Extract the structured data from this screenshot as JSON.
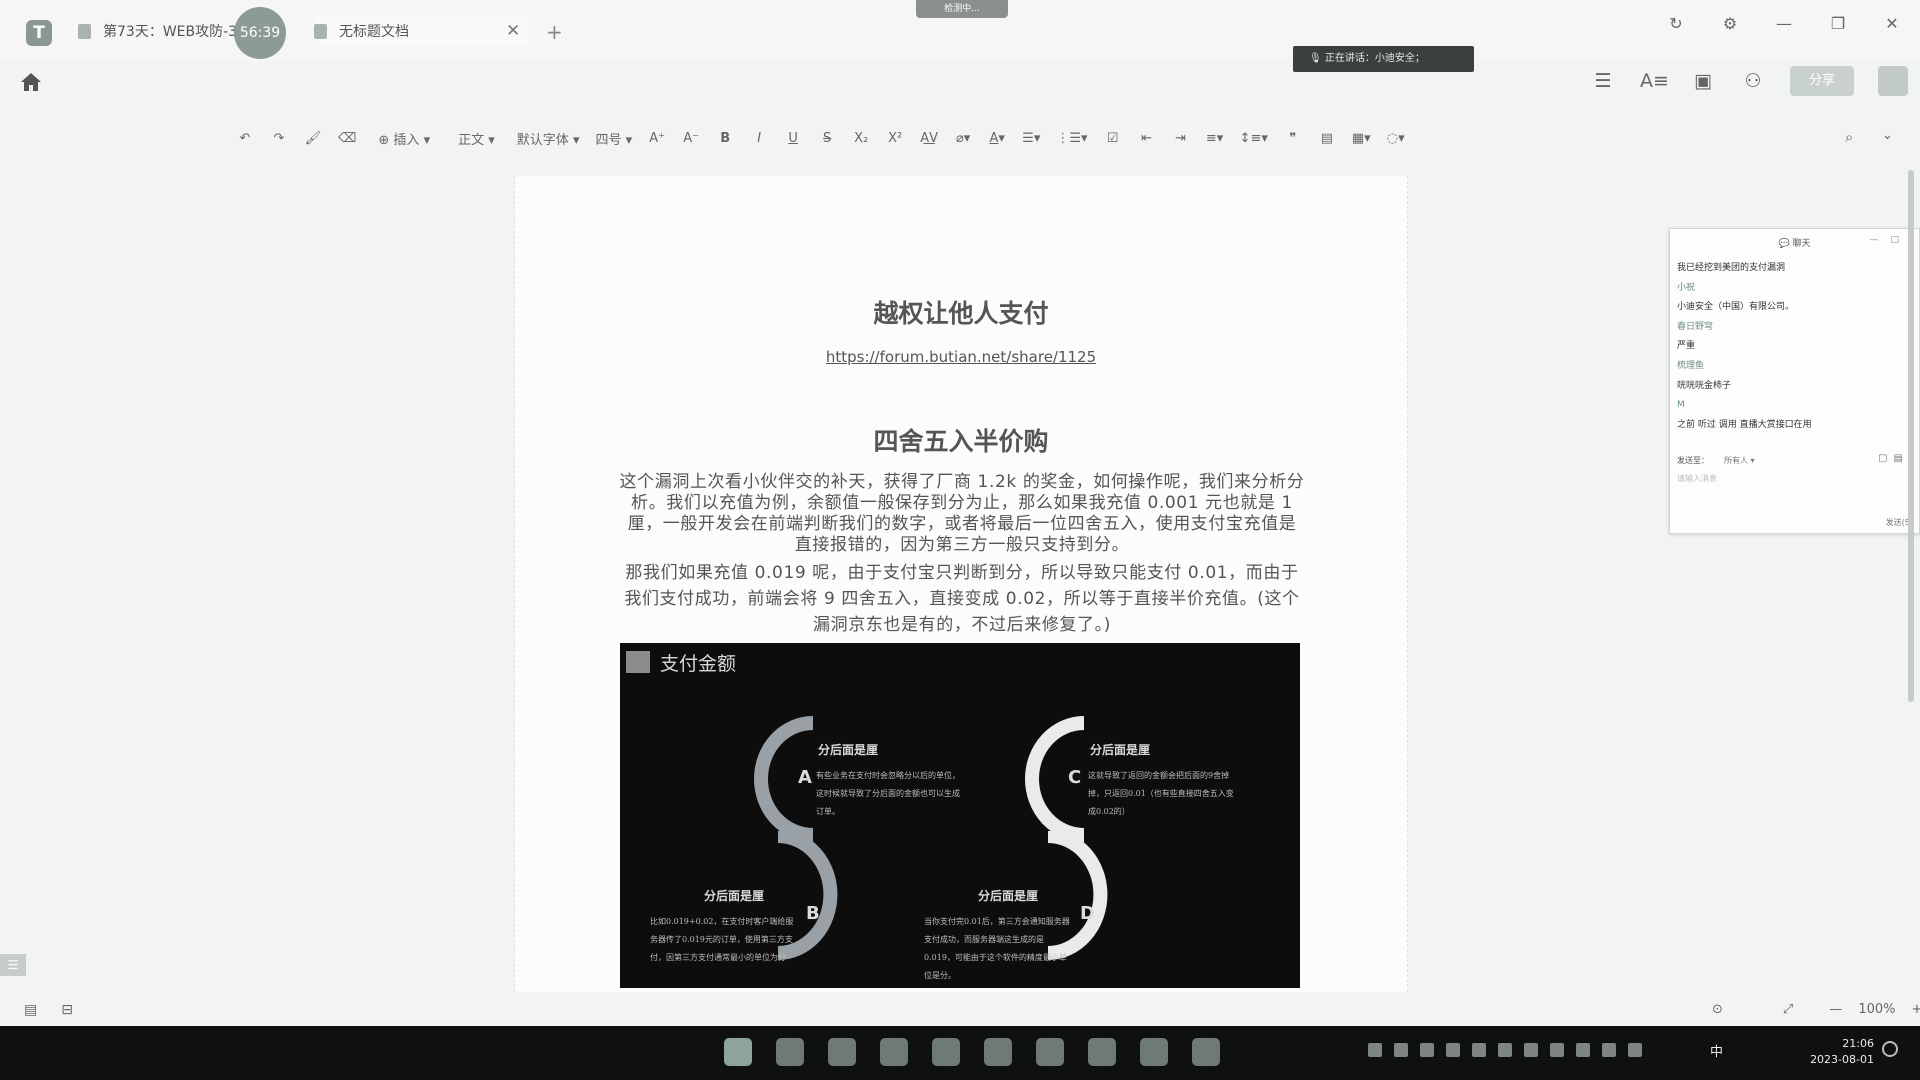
{
  "tabs": [
    {
      "label": "第73天：WEB攻防-3",
      "timer": "56:39"
    },
    {
      "label": "无标题文档"
    }
  ],
  "window": {
    "recording_badge": "检测中...",
    "speaking_label": "正在讲话：小迪安全；"
  },
  "header": {
    "share_label": "分享"
  },
  "toolbar": {
    "insert_label": "插入",
    "style_label": "正文",
    "font_label": "默认字体",
    "size_label": "四号"
  },
  "document": {
    "title1": "越权让他人支付",
    "link": "https://forum.butian.net/share/1125",
    "title2": "四舍五入半价购",
    "para1": "这个漏洞上次看小伙伴交的补天，获得了厂商 1.2k 的奖金，如何操作呢，我们来分析分析。我们以充值为例，余额值一般保存到分为止，那么如果我充值 0.001 元也就是 1 厘，一般开发会在前端判断我们的数字，或者将最后一位四舍五入，使用支付宝充值是直接报错的，因为第三方一般只支持到分。",
    "para2": "那我们如果充值 0.019 呢，由于支付宝只判断到分，所以导致只能支付 0.01，而由于我们支付成功，前端会将 9 四舍五入，直接变成 0.02，所以等于直接半价充值。(这个漏洞京东也是有的，不过后来修复了。)"
  },
  "figure": {
    "title": "支付金额",
    "blocks": [
      {
        "letter": "A",
        "heading": "分后面是厘",
        "text": "有些业务在支付时会忽略分以后的单位，这时候就导致了分后面的金额也可以生成订单。"
      },
      {
        "letter": "B",
        "heading": "分后面是厘",
        "text": "比如0.019+0.02，在支付时客户端给服务器传了0.019元的订单，使用第三方支付，因第三方支付通常最小的单位为分"
      },
      {
        "letter": "C",
        "heading": "分后面是厘",
        "text": "这就导致了返回的金额会把后面的9舍掉掉，只返回0.01（也有些直接四舍五入变成0.02的）"
      },
      {
        "letter": "D",
        "heading": "分后面是厘",
        "text": "当你支付完0.01后，第三方会通知服务器支付成功，而服务器端这生成的是0.019，可能由于这个软件的精度最小单位是分。"
      }
    ]
  },
  "chat": {
    "title": "聊天",
    "messages": [
      {
        "text": "我已经挖到美团的支付漏洞",
        "type": "msg"
      },
      {
        "text": "小祝",
        "type": "name"
      },
      {
        "text": "小迪安全（中国）有限公司。",
        "type": "msg"
      },
      {
        "text": "春日野穹",
        "type": "name"
      },
      {
        "text": "严重",
        "type": "msg"
      },
      {
        "text": "梳理鱼",
        "type": "name"
      },
      {
        "text": "咣咣咣金柿子",
        "type": "msg"
      },
      {
        "text": "M",
        "type": "name"
      },
      {
        "text": "之前 听过 调用 直播大赏接口在用",
        "type": "msg"
      }
    ],
    "send_to_label": "发送至：",
    "send_to_value": "所有人",
    "input_placeholder": "请输入消息",
    "send_label": "发送(S)"
  },
  "status": {
    "zoom": "100%"
  },
  "taskbar": {
    "ime": "中",
    "time": "21:06",
    "date": "2023-08-01"
  }
}
